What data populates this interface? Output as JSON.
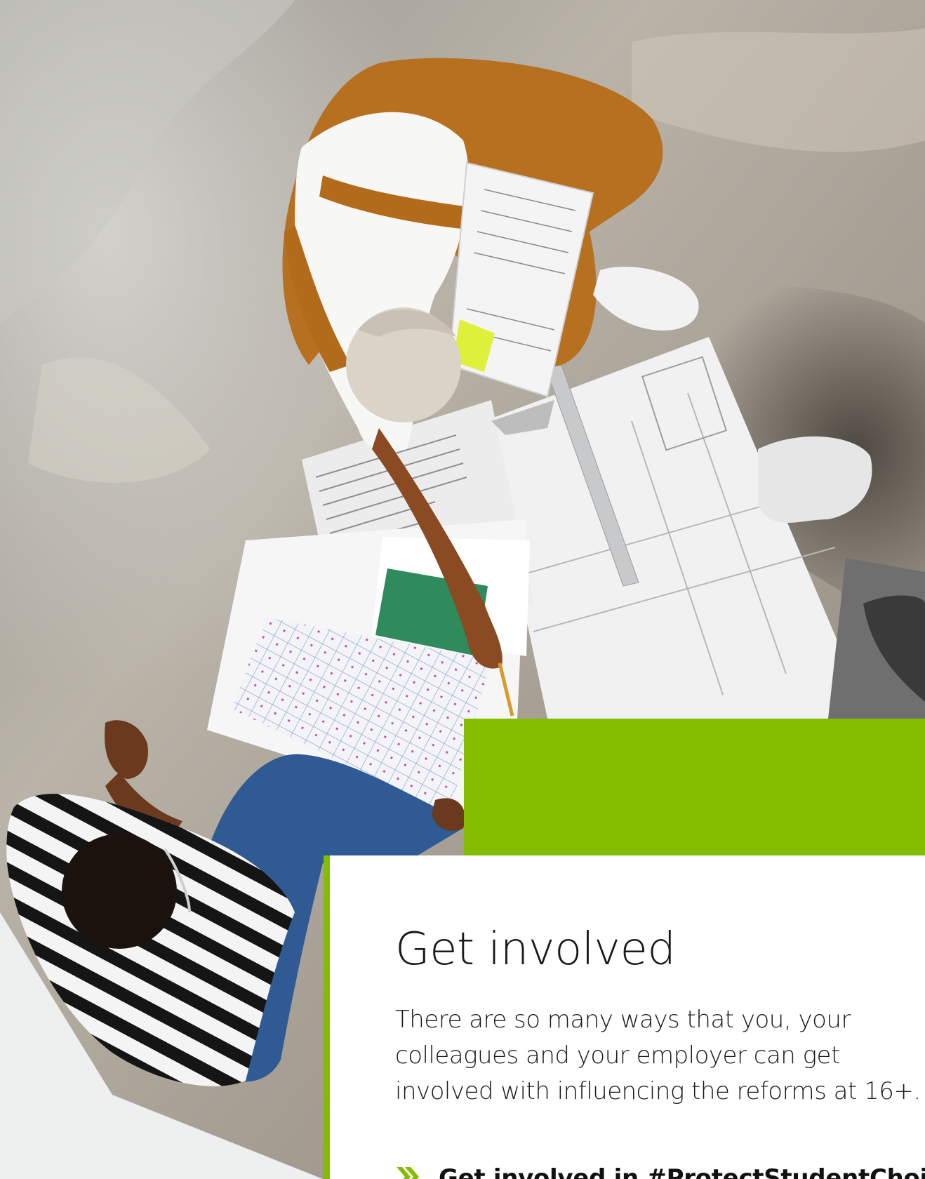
{
  "hero": {
    "image_alt": "Two people working on architectural plans spread on a concrete floor"
  },
  "colors": {
    "accent_green": "#84bd00",
    "text_dark": "#1a1a1a",
    "card_background": "#ffffff"
  },
  "card": {
    "title": "Get involved",
    "body": "There are so many ways that you, your colleagues and your employer can get involved with influencing the reforms at 16+.",
    "link_icon": "double-chevron-right-icon",
    "link_label": "Get involved in #ProtectStudentChoice"
  }
}
